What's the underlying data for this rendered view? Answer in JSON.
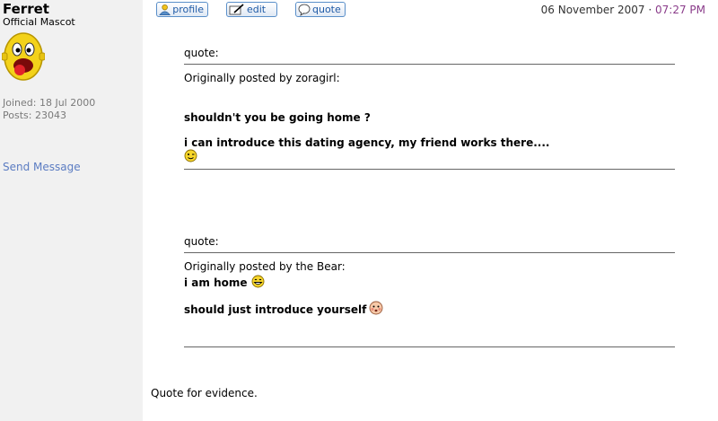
{
  "user": {
    "name": "Ferret",
    "title": "Official Mascot",
    "joined": "Joined: 18 Jul 2000",
    "posts": "Posts: 23043",
    "send_message": "Send Message"
  },
  "toolbar": {
    "profile_label": "profile",
    "edit_label": "edit",
    "quote_label": "quote"
  },
  "post": {
    "date": "06 November 2007",
    "separator": "·",
    "time": "07:27 PM",
    "quotes": [
      {
        "label": "quote:",
        "origin": "Originally posted by zoragirl:",
        "line1": "shouldn't you be going home ?",
        "line2": "i can introduce this dating agency, my friend works there...."
      },
      {
        "label": "quote:",
        "origin": "Originally posted by the Bear:",
        "line1": "i am home",
        "line2": "should just introduce yourself"
      }
    ],
    "body": "Quote for evidence."
  },
  "icons": [
    "profile-icon",
    "edit-icon",
    "quote-icon",
    "wink-smiley-icon",
    "grin-smiley-icon",
    "blush-smiley-icon"
  ]
}
